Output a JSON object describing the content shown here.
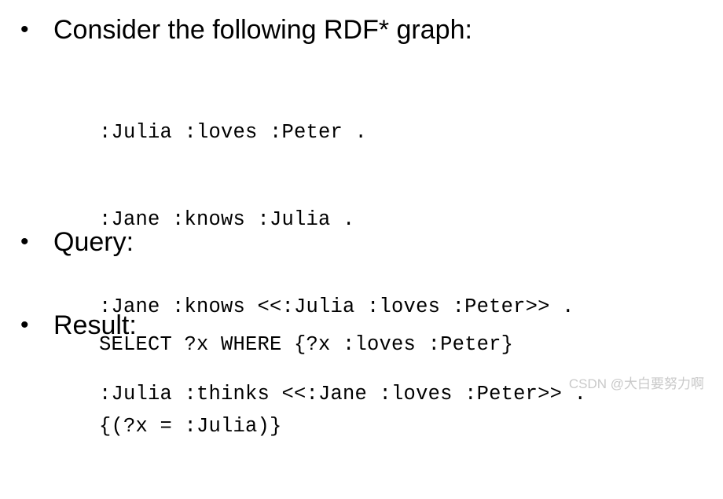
{
  "slide": {
    "background_color": "#ffffff",
    "text_color": "#000000",
    "bullet_glyph": "•"
  },
  "bullets": [
    {
      "id": "consider",
      "marker": "•",
      "label": "Consider the following RDF* graph:"
    },
    {
      "id": "query",
      "marker": "•",
      "label": "Query:"
    },
    {
      "id": "result",
      "marker": "•",
      "label": "Result:"
    }
  ],
  "graph_code": {
    "lines": [
      ":Julia :loves :Peter .",
      ":Jane :knows :Julia .",
      ":Jane :knows <<:Julia :loves :Peter>> .",
      ":Julia :thinks <<:Jane :loves :Peter>> ."
    ]
  },
  "query_code": {
    "lines": [
      "SELECT ?x WHERE {?x :loves :Peter}"
    ]
  },
  "result_code": {
    "lines": [
      "{(?x = :Julia)}"
    ]
  },
  "watermark": {
    "text": "CSDN @大白要努力啊",
    "color": "#c9c9c9"
  }
}
